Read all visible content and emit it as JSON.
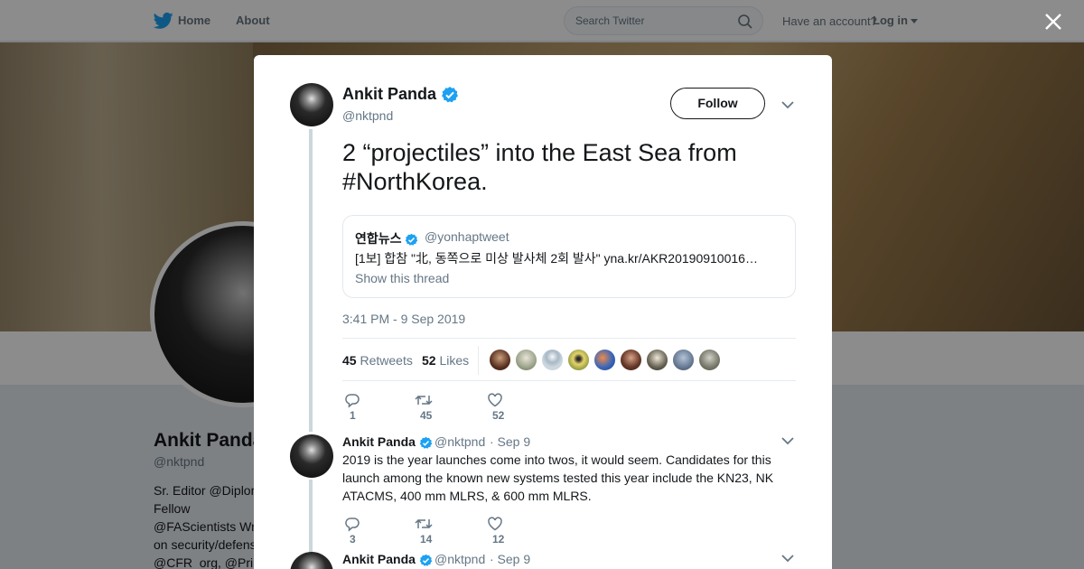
{
  "header": {
    "home_label": "Home",
    "about_label": "About",
    "search_placeholder": "Search Twitter",
    "have_account": "Have an account?",
    "login_label": "Log in"
  },
  "profile": {
    "name": "Ankit Panda",
    "handle": "@nktpnd",
    "bio_lines": [
      "Sr. Editor @Diplor",
      "Fellow",
      "@FAScientists Wri",
      "on security/defens",
      "@CFR_org, @Pri"
    ]
  },
  "main_tweet": {
    "author_name": "Ankit Panda",
    "author_handle": "@nktpnd",
    "follow_label": "Follow",
    "text": "2 “projectiles” into the East Sea from #NorthKorea.",
    "quote": {
      "name": "연합뉴스",
      "handle": "@yonhaptweet",
      "text": "[1보] 합참 \"北, 동쪽으로 미상 발사체 2회 발사\" yna.kr/AKR20190910016…",
      "show_thread": "Show this thread"
    },
    "timestamp": "3:41 PM - 9 Sep 2019",
    "retweets_count": "45",
    "retweets_label": "Retweets",
    "likes_count": "52",
    "likes_label": "Likes",
    "actions": {
      "replies": "1",
      "retweets": "45",
      "likes": "52"
    }
  },
  "replies": [
    {
      "author_name": "Ankit Panda",
      "author_handle": "@nktpnd",
      "date": "· Sep 9",
      "text": "2019 is the year launches come into twos, it would seem. Candidates for this launch among the known new systems tested this year include the KN23, NK ATACMS, 400 mm MLRS, & 600 mm MLRS.",
      "actions": {
        "replies": "3",
        "retweets": "14",
        "likes": "12"
      }
    },
    {
      "author_name": "Ankit Panda",
      "author_handle": "@nktpnd",
      "date": "· Sep 9"
    }
  ],
  "colors": {
    "accent": "#1da1f2",
    "muted": "#657786",
    "text": "#14171a"
  },
  "icons": [
    "twitter-bird-icon",
    "search-icon",
    "close-icon",
    "verified-icon",
    "chevron-down-icon",
    "reply-icon",
    "retweet-icon",
    "like-icon"
  ]
}
